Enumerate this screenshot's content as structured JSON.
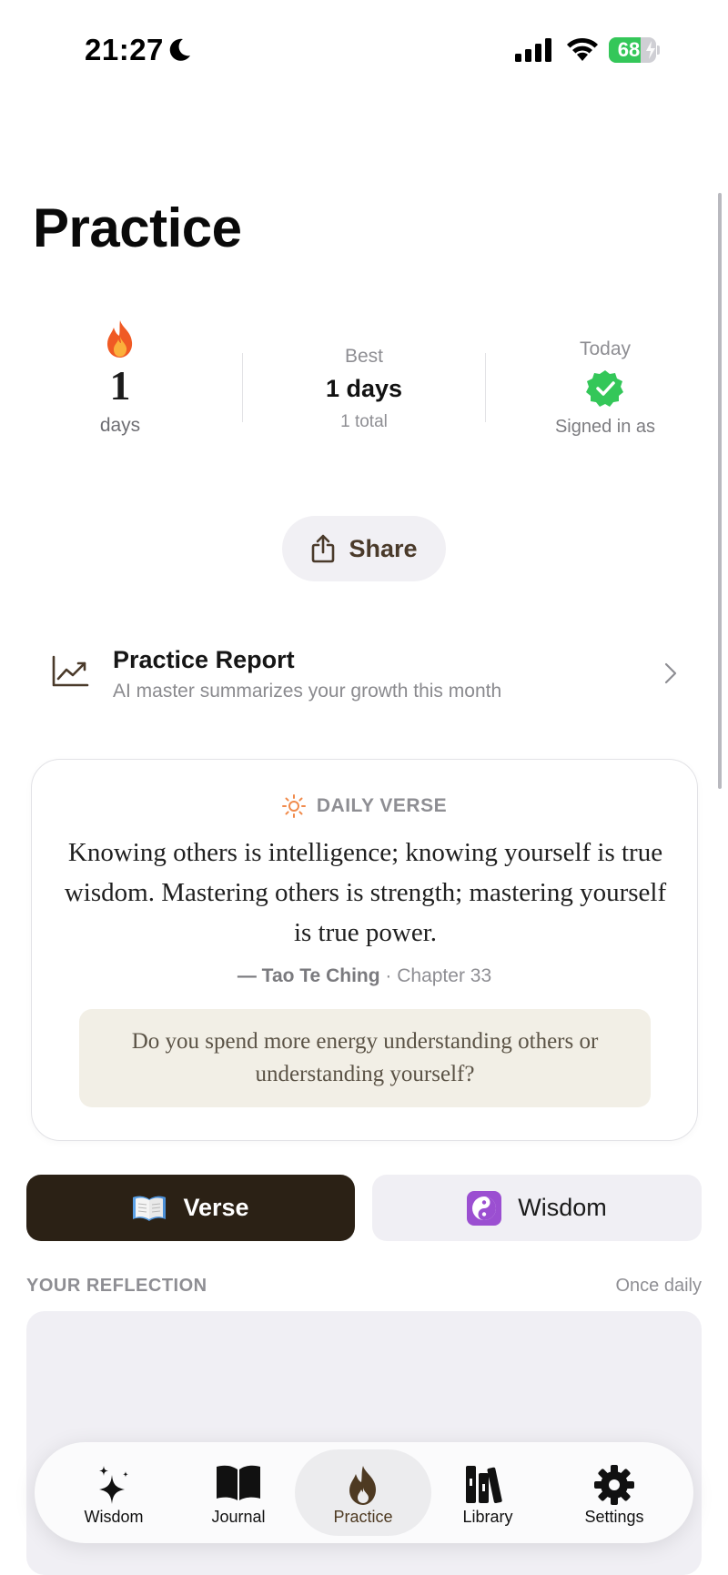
{
  "status_bar": {
    "time": "21:27",
    "battery_percent": "68",
    "battery_level": 0.68,
    "icons": [
      "moon-icon",
      "cellular-signal-icon",
      "wifi-icon",
      "battery-charging-icon"
    ]
  },
  "page": {
    "title": "Practice"
  },
  "stats": {
    "streak": {
      "icon": "fire-emoji",
      "value": "1",
      "unit": "days"
    },
    "best": {
      "label": "Best",
      "value": "1 days",
      "total": "1 total"
    },
    "today": {
      "label": "Today",
      "icon": "check-badge-icon",
      "status_text": "Signed in as",
      "badge_color": "#34c759"
    }
  },
  "share": {
    "label": "Share",
    "icon": "share-icon"
  },
  "report": {
    "title": "Practice Report",
    "subtitle": "AI master summarizes your growth this month",
    "icon": "trend-chart-icon"
  },
  "daily_verse": {
    "header": "DAILY VERSE",
    "icon": "sun-icon",
    "text": "Knowing others is intelligence; knowing yourself is true wisdom. Mastering others is strength; mastering yourself is true power.",
    "source_book": "— Tao Te Ching",
    "source_chapter": "· Chapter 33",
    "question": "Do you spend more energy understanding others or understanding yourself?"
  },
  "mode_toggle": {
    "verse": {
      "label": "Verse",
      "icon": "open-book-emoji",
      "selected": true
    },
    "wisdom": {
      "label": "Wisdom",
      "icon": "yin-yang-emoji",
      "selected": false
    }
  },
  "reflection": {
    "label": "YOUR REFLECTION",
    "frequency": "Once daily",
    "value": ""
  },
  "tabbar": {
    "tabs": [
      {
        "label": "Wisdom",
        "icon": "sparkles-icon",
        "active": false
      },
      {
        "label": "Journal",
        "icon": "book-icon",
        "active": false
      },
      {
        "label": "Practice",
        "icon": "flame-icon",
        "active": true
      },
      {
        "label": "Library",
        "icon": "books-icon",
        "active": false
      },
      {
        "label": "Settings",
        "icon": "gear-icon",
        "active": false
      }
    ]
  },
  "colors": {
    "accent_dark": "#2b2115",
    "accent_brown": "#4a3a2a",
    "question_bg": "#f2efe6",
    "success_green": "#34c759"
  }
}
